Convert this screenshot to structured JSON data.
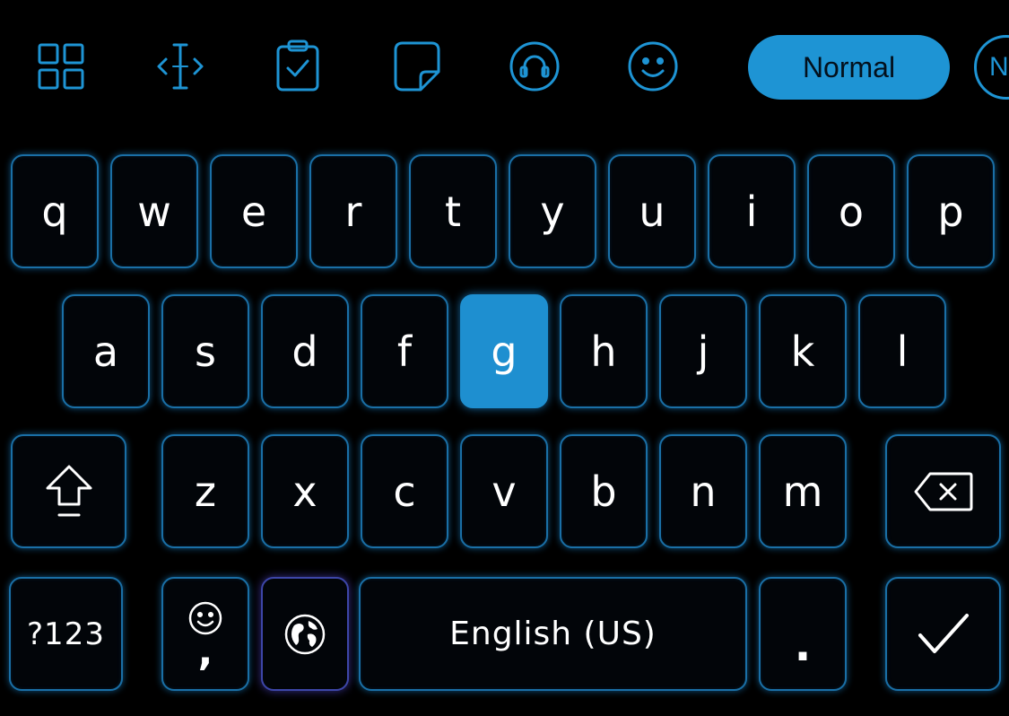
{
  "toolbar": {
    "icons": [
      "grid-icon",
      "text-cursor-icon",
      "clipboard-icon",
      "sticky-note-icon",
      "headphones-icon",
      "smiley-icon"
    ],
    "mode_label": "Normal",
    "next_pill_label": "N"
  },
  "keyboard": {
    "row1": [
      "q",
      "w",
      "e",
      "r",
      "t",
      "y",
      "u",
      "i",
      "o",
      "p"
    ],
    "row2": [
      "a",
      "s",
      "d",
      "f",
      "g",
      "h",
      "j",
      "k",
      "l"
    ],
    "row3": [
      "z",
      "x",
      "c",
      "v",
      "b",
      "n",
      "m"
    ],
    "symbols_label": "?123",
    "comma_label": ",",
    "space_label": "English (US)",
    "period_label": ".",
    "highlighted_key": "g"
  },
  "colors": {
    "accent": "#1e94d4",
    "background": "#000000",
    "key_border": "#1a6fa6",
    "globe_border": "#3d46a8"
  }
}
